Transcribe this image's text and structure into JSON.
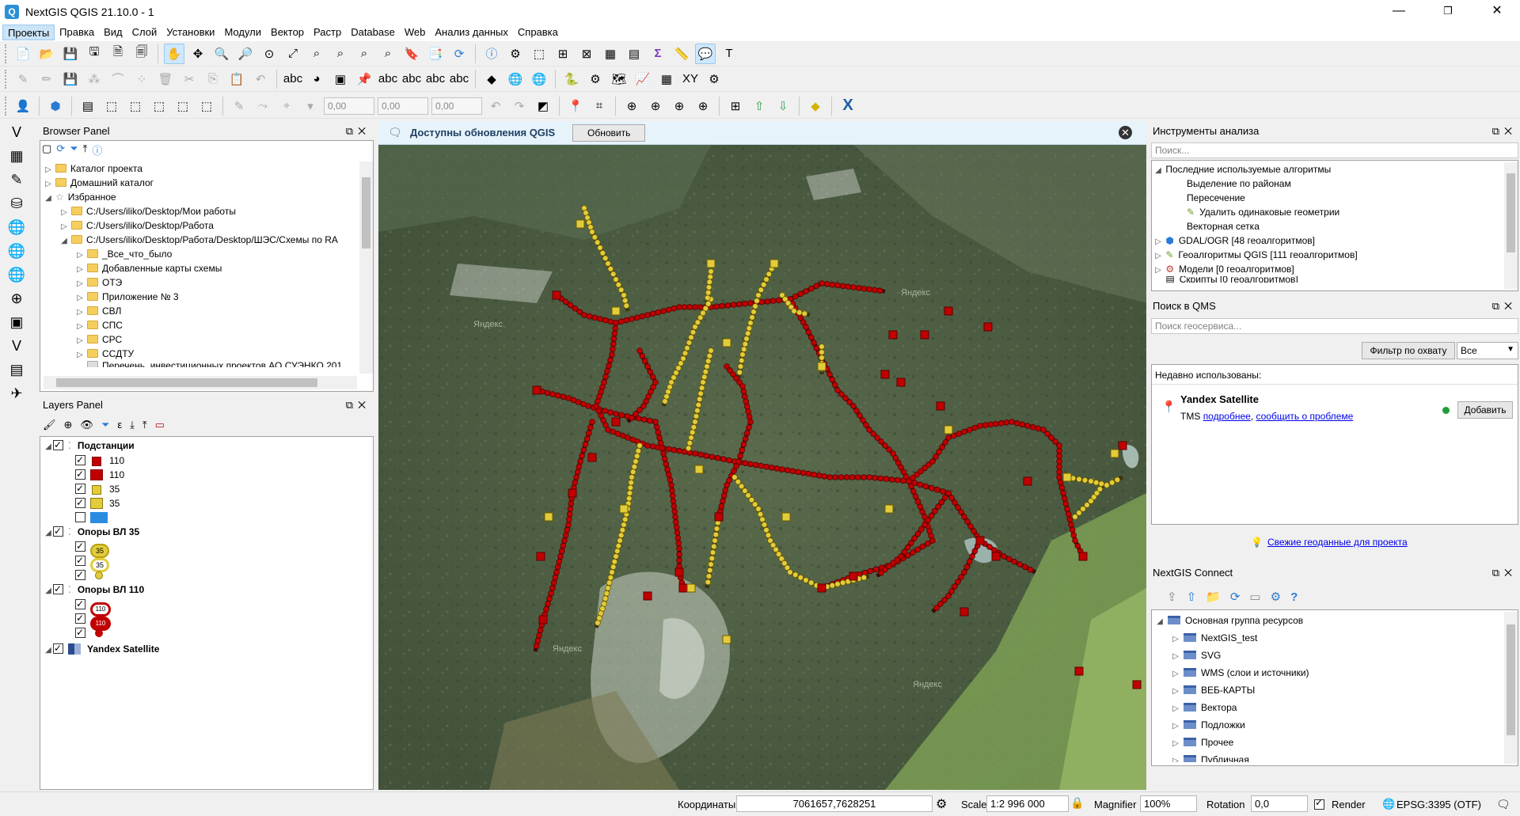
{
  "window": {
    "title": "NextGIS QGIS 21.10.0 - 1",
    "minimize": "—",
    "maximize": "❐",
    "close": "✕"
  },
  "menu": [
    "Проекты",
    "Правка",
    "Вид",
    "Слой",
    "Установки",
    "Модули",
    "Вектор",
    "Растр",
    "Database",
    "Web",
    "Анализ данных",
    "Справка"
  ],
  "toolbar": {
    "coord_x": "0,00",
    "coord_y": "0,00",
    "coord_z": "0,00"
  },
  "browser": {
    "title": "Browser Panel",
    "items": [
      {
        "label": "Каталог проекта"
      },
      {
        "label": "Домашний каталог"
      },
      {
        "label": "Избранное"
      },
      {
        "label": "C:/Users/iliko/Desktop/Мои работы"
      },
      {
        "label": "C:/Users/iliko/Desktop/Работа"
      },
      {
        "label": "C:/Users/iliko/Desktop/Работа/Desktop/ШЭС/Схемы по RA"
      },
      {
        "label": "_Все_что_было"
      },
      {
        "label": "Добавленные карты схемы"
      },
      {
        "label": "ОТЭ"
      },
      {
        "label": "Приложение № 3"
      },
      {
        "label": "СВЛ"
      },
      {
        "label": "СПС"
      },
      {
        "label": "СРС"
      },
      {
        "label": "ССДТУ"
      },
      {
        "label": "Перечень_инвестиционных проектов АО СУЭНКО 201"
      }
    ]
  },
  "layers": {
    "title": "Layers Panel",
    "groups": [
      {
        "name": "Подстанции",
        "items": [
          "110",
          "110",
          "35",
          "35",
          ""
        ]
      },
      {
        "name": "Опоры ВЛ 35",
        "items": [
          "35",
          "35",
          ""
        ]
      },
      {
        "name": "Опоры ВЛ 110",
        "items": [
          "110",
          "110",
          ""
        ]
      },
      {
        "name": "Yandex Satellite",
        "items": []
      }
    ]
  },
  "notice": {
    "text": "Доступны обновления QGIS",
    "button": "Обновить"
  },
  "map": {
    "watermark": "Яндекс",
    "colors": {
      "red": "#c00000",
      "yellow": "#e3cc3a"
    }
  },
  "analysis": {
    "title": "Инструменты анализа",
    "search_placeholder": "Поиск...",
    "recent_label": "Последние используемые алгоритмы",
    "recent": [
      "Выделение по районам",
      "Пересечение",
      "Удалить одинаковые геометрии",
      "Векторная сетка"
    ],
    "providers": [
      "GDAL/OGR [48 геоалгоритмов]",
      "Геоалгоритмы QGIS [111 геоалгоритмов]",
      "Модели [0 геоалгоритмов]",
      "Скрипты [0 геоалгоритмов]"
    ]
  },
  "qms": {
    "title": "Поиск в QMS",
    "search_placeholder": "Поиск геосервиса...",
    "filter_button": "Фильтр по охвату",
    "filter_value": "Все",
    "recent_label": "Недавно использованы:",
    "service_name": "Yandex Satellite",
    "service_type": "TMS",
    "link_more": "подробнее",
    "link_sep": ",",
    "link_report": "сообщить о проблеме",
    "add_button": "Добавить",
    "fresh_link": "Свежие геоданные для проекта"
  },
  "nextgis": {
    "title": "NextGIS Connect",
    "root": "Основная группа ресурсов",
    "items": [
      "NextGIS_test",
      "SVG",
      "WMS (слои и источники)",
      "ВЕБ-КАРТЫ",
      "Вектора",
      "Подложки",
      "Прочее",
      "Публичная"
    ]
  },
  "status": {
    "coord_label": "Координаты",
    "coord_value": "7061657,7628251",
    "scale_label": "Scale",
    "scale_value": "1:2 996 000",
    "magnifier_label": "Magnifier",
    "magnifier_value": "100%",
    "rotation_label": "Rotation",
    "rotation_value": "0,0",
    "render_label": "Render",
    "crs": "EPSG:3395 (OTF)"
  }
}
